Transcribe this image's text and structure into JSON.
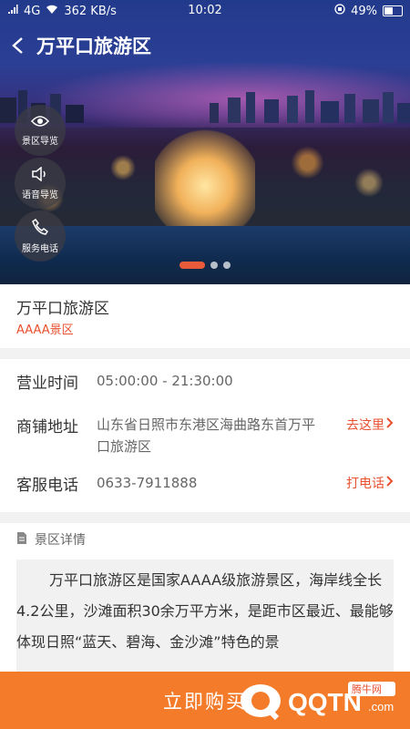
{
  "status_bar": {
    "network": "4G",
    "speed": "362 KB/s",
    "time": "10:02",
    "battery": "49%",
    "battery_level": 0.49
  },
  "title": "万平口旅游区",
  "side_buttons": [
    {
      "label": "景区导览",
      "icon": "eye-icon"
    },
    {
      "label": "语音导览",
      "icon": "speaker-icon"
    },
    {
      "label": "服务电话",
      "icon": "phone-icon"
    }
  ],
  "carousel": {
    "count": 3,
    "active_index": 0
  },
  "info": {
    "name": "万平口旅游区",
    "grade": "AAAA景区"
  },
  "details": {
    "hours_label": "营业时间",
    "hours_value": "05:00:00 - 21:30:00",
    "address_label": "商铺地址",
    "address_value": "山东省日照市东港区海曲路东首万平口旅游区",
    "address_action": "去这里",
    "phone_label": "客服电话",
    "phone_value": "0633-7911888",
    "phone_action": "打电话"
  },
  "scenic": {
    "header": "景区详情",
    "text": "万平口旅游区是国家AAAA级旅游景区，海岸线全长4.2公里，沙滩面积30余万平方米，是距市区最近、最能够体现日照“蓝天、碧海、金沙滩”特色的景"
  },
  "buy_button": "立即购买",
  "watermark": {
    "brand": "QQTN.com",
    "sub": "腾牛网"
  },
  "colors": {
    "accent": "#e8502f",
    "buy_bar": "#f47b2a"
  }
}
